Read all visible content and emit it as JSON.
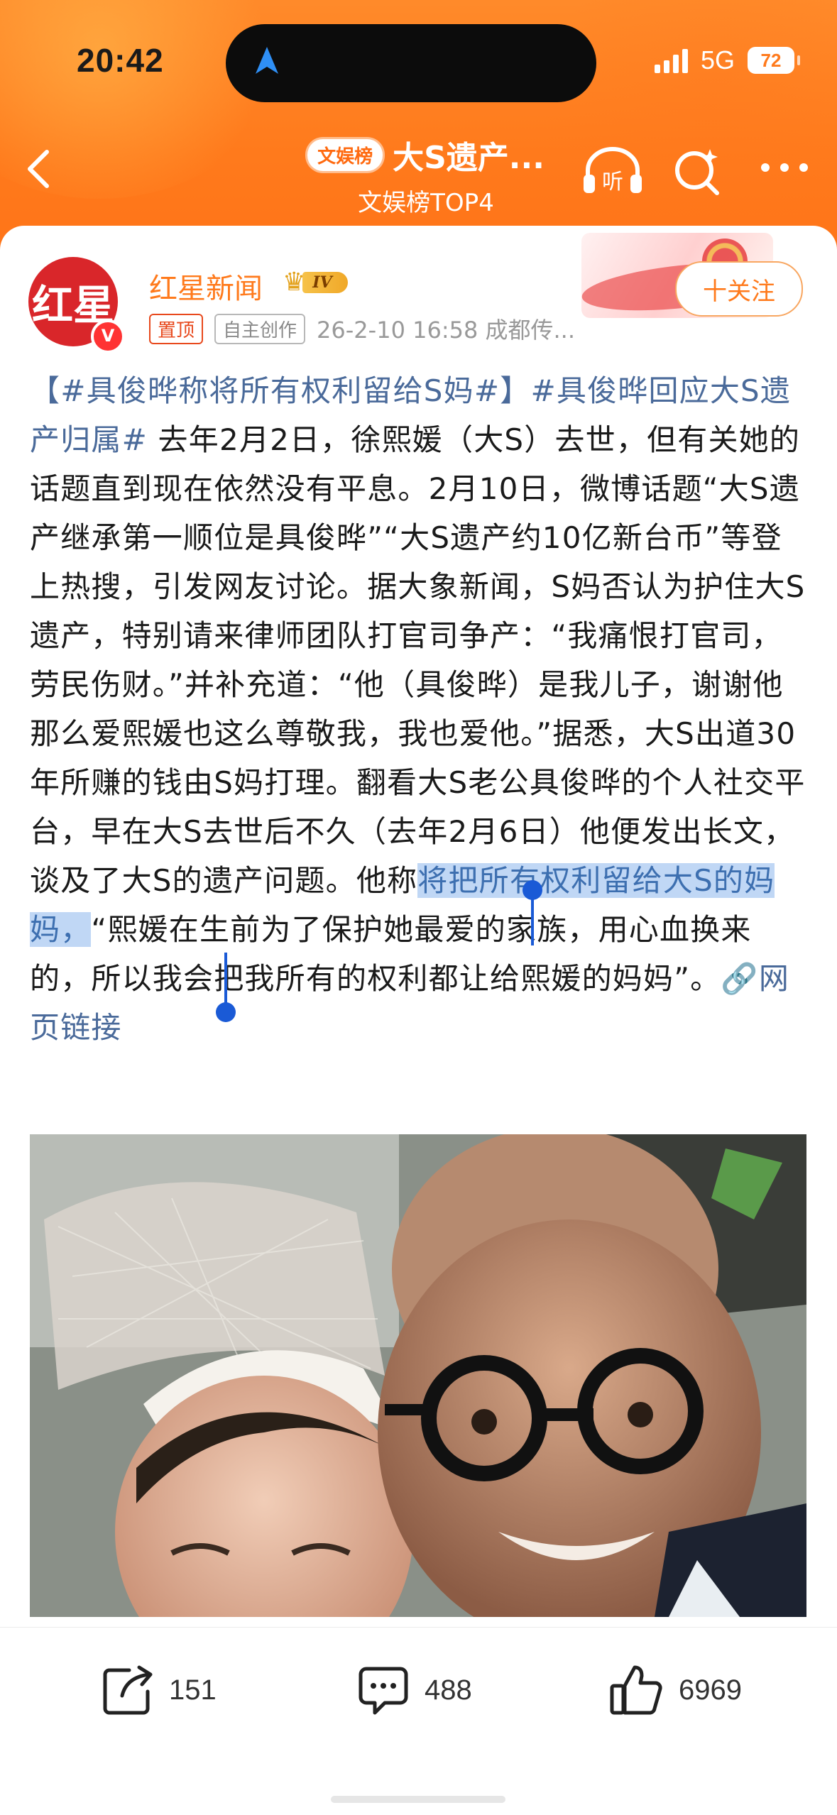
{
  "status_bar": {
    "time": "20:42",
    "network": "5G",
    "battery": "72",
    "location_icon": "navigation-arrow-icon"
  },
  "nav": {
    "badge": "文娱榜",
    "title": "大S遗产...",
    "subtitle": "文娱榜TOP4",
    "back_icon": "chevron-left-icon",
    "listen_icon": "headphones-listen-icon",
    "listen_label": "听",
    "search_icon": "search-sparkle-icon",
    "more_icon": "more-dots-icon"
  },
  "post": {
    "author": {
      "name": "红星新闻",
      "avatar_text": "红星",
      "verified_badge": "V",
      "level": "IV"
    },
    "tags": [
      "置顶",
      "自主创作"
    ],
    "meta": "26-2-10 16:58  成都传...",
    "follow_label": "十关注",
    "body": {
      "topic1": "【#具俊晔称将所有权利留给S妈#】",
      "topic2": "#具俊晔回应大S遗产归属#",
      "text1": " 去年2月2日，徐熙媛（大S）去世，但有关她的话题直到现在依然没有平息。2月10日，微博话题“大S遗产继承第一顺位是具俊晔”“大S遗产约10亿新台币”等登上热搜，引发网友讨论。据大象新闻，S妈否认为护住大S遗产，特别请来律师团队打官司争产：“我痛恨打官司，劳民伤财。”并补充道：“他（具俊晔）是我儿子，谢谢他那么爱熙媛也这么尊敬我，我也爱他。”据悉，大S出道30年所赚的钱由S妈打理。翻看大S老公具俊晔的个人社交平台，早在大S去世后不久（去年2月6日）他便发出长文，谈及了大S的遗产问题。他称",
      "selected": "将把所有权利留给大S的妈妈，",
      "text2": "“熙媛在生前为了保护她最爱的家族，用心血换来的，所以我会把我所有的权利都让给熙媛的妈妈”。",
      "link_label": "网页链接",
      "link_icon": "link-icon"
    }
  },
  "actions": {
    "repost": {
      "icon": "share-icon",
      "count": "151"
    },
    "comment": {
      "icon": "comment-icon",
      "count": "488"
    },
    "like": {
      "icon": "thumbs-up-icon",
      "count": "6969"
    }
  },
  "colors": {
    "header": "#ff7a1c",
    "topic": "#4a6a9a",
    "selection": "#5a96e6",
    "name": "#ff7a1c"
  }
}
